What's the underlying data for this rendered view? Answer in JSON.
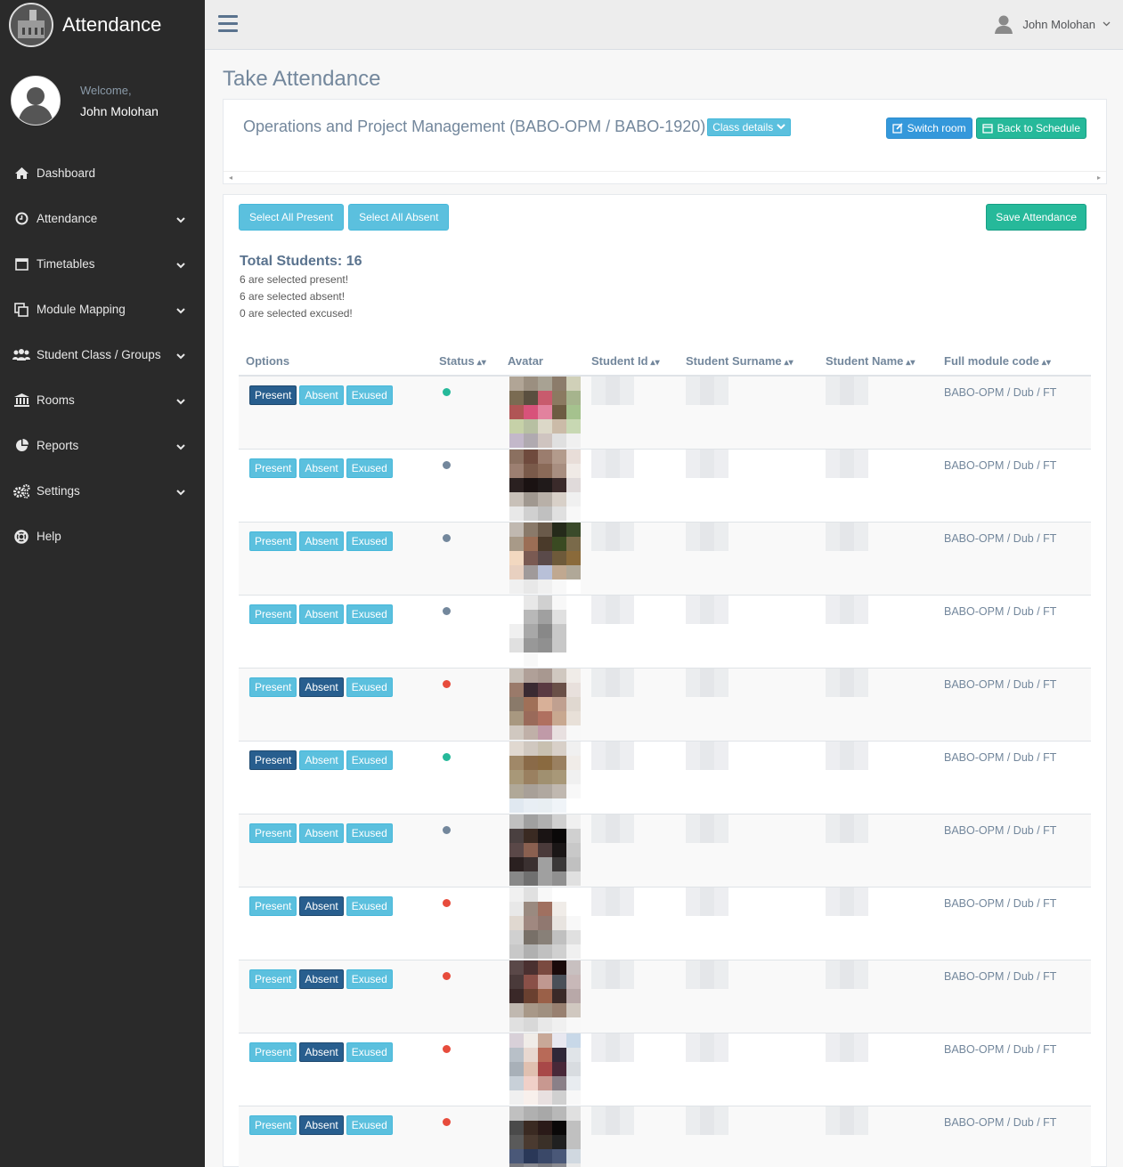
{
  "app": {
    "title": "Attendance"
  },
  "profile": {
    "welcome": "Welcome,",
    "name": "John Molohan"
  },
  "menu": [
    {
      "label": "Dashboard",
      "icon": "home-icon",
      "has_children": false
    },
    {
      "label": "Attendance",
      "icon": "clock-icon",
      "has_children": true
    },
    {
      "label": "Timetables",
      "icon": "calendar-icon",
      "has_children": true
    },
    {
      "label": "Module Mapping",
      "icon": "clone-icon",
      "has_children": true
    },
    {
      "label": "Student Class / Groups",
      "icon": "users-icon",
      "has_children": true
    },
    {
      "label": "Rooms",
      "icon": "university-icon",
      "has_children": true
    },
    {
      "label": "Reports",
      "icon": "pie-chart-icon",
      "has_children": true
    },
    {
      "label": "Settings",
      "icon": "cogs-icon",
      "has_children": true
    },
    {
      "label": "Help",
      "icon": "life-ring-icon",
      "has_children": false
    }
  ],
  "topnav": {
    "user": "John Molohan"
  },
  "page": {
    "title": "Take Attendance",
    "course": "Operations and Project Management (BABO-OPM / BABO-1920)",
    "class_details": "Class details",
    "switch_room": "Switch room",
    "back_to_schedule": "Back to Schedule"
  },
  "controls": {
    "select_all_present": "Select All Present",
    "select_all_absent": "Select All Absent",
    "save": "Save Attendance"
  },
  "summary": {
    "total": "Total Students: 16",
    "present": "6 are selected present!",
    "absent": "6 are selected absent!",
    "excused": "0 are selected excused!"
  },
  "table": {
    "columns": [
      "Options",
      "Status",
      "Avatar",
      "Student Id",
      "Student Surname",
      "Student Name",
      "Full module code"
    ],
    "option_labels": {
      "present": "Present",
      "absent": "Absent",
      "excused": "Exused"
    },
    "rows": [
      {
        "selected": "present",
        "status": "present",
        "module": "BABO-OPM / Dub / FT"
      },
      {
        "selected": "none",
        "status": "none",
        "module": "BABO-OPM / Dub / FT"
      },
      {
        "selected": "none",
        "status": "none",
        "module": "BABO-OPM / Dub / FT"
      },
      {
        "selected": "none",
        "status": "none",
        "module": "BABO-OPM / Dub / FT"
      },
      {
        "selected": "absent",
        "status": "absent",
        "module": "BABO-OPM / Dub / FT"
      },
      {
        "selected": "present",
        "status": "present",
        "module": "BABO-OPM / Dub / FT"
      },
      {
        "selected": "none",
        "status": "none",
        "module": "BABO-OPM / Dub / FT"
      },
      {
        "selected": "absent",
        "status": "absent",
        "module": "BABO-OPM / Dub / FT"
      },
      {
        "selected": "absent",
        "status": "absent",
        "module": "BABO-OPM / Dub / FT"
      },
      {
        "selected": "absent",
        "status": "absent",
        "module": "BABO-OPM / Dub / FT"
      },
      {
        "selected": "absent",
        "status": "absent",
        "module": "BABO-OPM / Dub / FT"
      }
    ]
  },
  "colors": {
    "sidebar": "#2a2a2a",
    "info": "#5bc0de",
    "success": "#26b99a",
    "active": "#285e8e",
    "absent_dot": "#e74c3c"
  }
}
